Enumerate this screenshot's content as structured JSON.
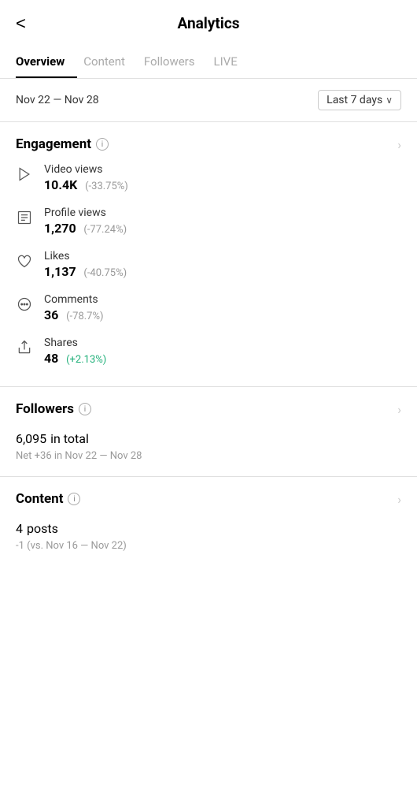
{
  "header": {
    "back_label": "<",
    "title": "Analytics"
  },
  "tabs": [
    {
      "label": "Overview",
      "active": true
    },
    {
      "label": "Content",
      "active": false
    },
    {
      "label": "Followers",
      "active": false
    },
    {
      "label": "LIVE",
      "active": false
    }
  ],
  "date": {
    "range": "Nov 22 — Nov 28",
    "selector": "Last 7 days"
  },
  "engagement": {
    "title": "Engagement",
    "metrics": [
      {
        "key": "video_views",
        "label": "Video views",
        "value": "10.4K",
        "change": "(-33.75%)",
        "positive": false
      },
      {
        "key": "profile_views",
        "label": "Profile views",
        "value": "1,270",
        "change": "(-77.24%)",
        "positive": false
      },
      {
        "key": "likes",
        "label": "Likes",
        "value": "1,137",
        "change": "(-40.75%)",
        "positive": false
      },
      {
        "key": "comments",
        "label": "Comments",
        "value": "36",
        "change": "(-78.7%)",
        "positive": false
      },
      {
        "key": "shares",
        "label": "Shares",
        "value": "48",
        "change": "(+2.13%)",
        "positive": true
      }
    ]
  },
  "followers": {
    "title": "Followers",
    "total": "6,095",
    "total_label": "in total",
    "net": "Net +36 in Nov 22 — Nov 28"
  },
  "content": {
    "title": "Content",
    "posts": "4",
    "posts_label": "posts",
    "sub": "-1 (vs. Nov 16 — Nov 22)"
  },
  "icons": {
    "info": "i",
    "chevron_right": "›",
    "chevron_down": "∨"
  }
}
